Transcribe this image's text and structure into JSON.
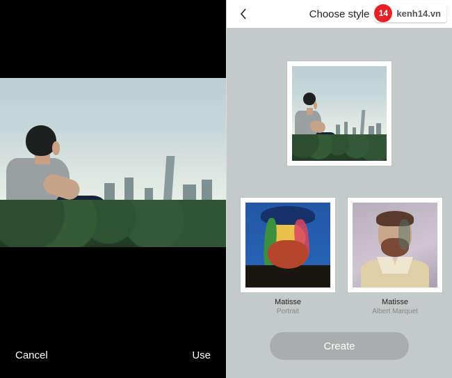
{
  "left": {
    "cancel_label": "Cancel",
    "use_label": "Use"
  },
  "right": {
    "header_title": "Choose style",
    "styles": [
      {
        "title": "Matisse",
        "subtitle": "Portrait"
      },
      {
        "title": "Matisse",
        "subtitle": "Albert Marquet"
      }
    ],
    "create_label": "Create"
  },
  "watermark": {
    "badge_number": "14",
    "text": "kenh14.vn"
  }
}
